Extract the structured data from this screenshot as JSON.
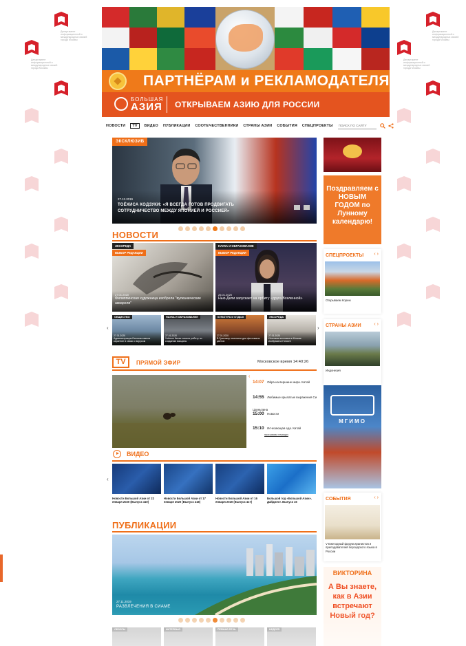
{
  "side": {
    "dept_caption": "Департамент информационной и международных связей города Москвы",
    "dept_line1": "Департамент",
    "dept_line2": "внешнеэкономических",
    "dept_line3": "и международных связей",
    "dept_line4": "города Москвы"
  },
  "banner": {
    "partners_text": "ПАРТНЁРАМ и РЕКЛАМОДАТЕЛЯМ",
    "logo_small": "БОЛЬШАЯ",
    "logo_big": "АЗИЯ",
    "slogan": "ОТКРЫВАЕМ АЗИЮ ДЛЯ РОССИИ"
  },
  "nav": {
    "items": [
      "НОВОСТИ",
      "TV",
      "ВИДЕО",
      "ПУБЛИКАЦИИ",
      "СООТЕЧЕСТВЕННИКИ",
      "СТРАНЫ АЗИИ",
      "СОБЫТИЯ",
      "СПЕЦПРОЕКТЫ"
    ],
    "search_placeholder": "ПОИСК ПО САЙТУ"
  },
  "hero": {
    "tag": "ЭКСКЛЮЗИВ",
    "date": "27.12.2019",
    "title": "ТОЁХИСА КОДЗУКИ: «Я ВСЕГДА ГОТОВ ПРОДВИГАТЬ СОТРУДНИЧЕСТВО МЕЖДУ ЯПОНИЕЙ И РОССИЕЙ»"
  },
  "news": {
    "heading": "НОВОСТИ",
    "big": [
      {
        "category": "ЭКСОРЕДА",
        "pick": "ВЫБОР РЕДАКЦИИ",
        "date": "27.01.2020",
        "title": "Филиппинская художница изобрела \"вулканические акварели\""
      },
      {
        "category": "НАУКА И ОБРАЗОВАНИЕ",
        "pick": "ВЫБОР РЕДАКЦИИ",
        "date": "26.01.2020",
        "title": "Нью-Дели запускает на орбиту «друга Вселенной»"
      }
    ],
    "small": [
      {
        "category": "ОБЩЕСТВО",
        "date": "27.01.2020",
        "title": "Администрация Бангкока ввела карантин в связи с вирусом"
      },
      {
        "category": "НАУКА И ОБРАЗОВАНИЕ",
        "date": "27.01.2020",
        "title": "Учёные Китая начали работу по созданию вакцины"
      },
      {
        "category": "КУЛЬТУРА И ОТДЫХ",
        "date": "27.01.2020",
        "title": "В Гуанчжоу отменили дни фестиваля цветов"
      },
      {
        "category": "ЭКСОРЕДА",
        "date": "27.01.2020",
        "title": "Итоговая выставка в Москве изобразила Гонконг"
      }
    ]
  },
  "tv": {
    "logo": "TV",
    "live": "ПРЯМОЙ ЭФИР",
    "moscow_time": "Московское время 14:40:26",
    "schedule": [
      {
        "time": "14:07",
        "title": "Ойра на вершине мира. Китай"
      },
      {
        "time": "14:55",
        "title": "Любимые крылатые выражения Си Цзиньпина"
      },
      {
        "time": "15:00",
        "title": "Новости"
      },
      {
        "time": "15:10",
        "title": "Исчезающая еда. Китай"
      }
    ],
    "program_link": "программа передач"
  },
  "video": {
    "heading": "ВИДЕО",
    "cards": [
      {
        "caption": "Новости Большой Азии от 22 января 2020 (Выпуск 419)"
      },
      {
        "caption": "Новости Большой Азии от 17 января 2020 (Выпуск 418)"
      },
      {
        "caption": "Новости Большой Азии от 16 января 2020 (Выпуск 417)"
      },
      {
        "caption": "Большой год «Большой Азии». Дайджест. Выпуск 16"
      }
    ]
  },
  "publications": {
    "heading": "ПУБЛИКАЦИИ",
    "date": "27.11.2019",
    "title": "РАЗВЛЕЧЕНИЯ В СИАМЕ",
    "bottom_categories": [
      "ОБЗОРЫ",
      "ИНТЕРВЬЮ",
      "ПРЯМАЯ РЕЧЬ",
      "НЕДЕЛЯ"
    ]
  },
  "right": {
    "ny_ad": "Поздравляем с НОВЫМ ГОДОМ по Лунному календарю!",
    "special": {
      "heading": "СПЕЦПРОЕКТЫ",
      "caption": "Открываем Корею"
    },
    "countries": {
      "heading": "СТРАНЫ АЗИИ",
      "caption": "Индонезия"
    },
    "mgimo": "МГИМО",
    "events": {
      "heading": "СОБЫТИЯ",
      "caption": "V Ежегодный форум иранистов и преподавателей персидского языка в России"
    },
    "quiz": {
      "heading": "ВИКТОРИНА",
      "text": "А Вы знаете, как в Азии встречают Новый год?"
    }
  },
  "colors": {
    "accent": "#ef6f19",
    "banner_red": "#e4541f",
    "banner_orange": "#ef7a1a"
  }
}
